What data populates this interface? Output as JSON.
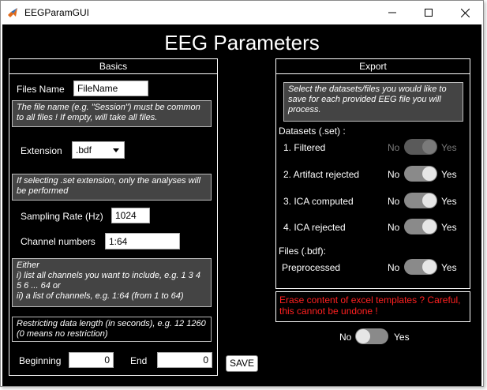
{
  "window": {
    "title": "EEGParamGUI"
  },
  "app": {
    "title": "EEG Parameters"
  },
  "basics": {
    "header": "Basics",
    "files_name_label": "Files Name",
    "files_name_value": "FileName",
    "files_name_note": "The file name (e.g. \"Session\") must be common to all files ! If empty, will take all files.",
    "extension_label": "Extension",
    "extension_value": ".bdf",
    "extension_note": "If selecting .set extension, only the analyses will be performed",
    "sampling_rate_label": "Sampling Rate (Hz)",
    "sampling_rate_value": "1024",
    "channel_numbers_label": "Channel numbers",
    "channel_numbers_value": "1:64",
    "channel_note": "Either\ni) list all channels you want to include, e.g. 1 3 4 5 6 ... 64 or\nii) a list of channels, e.g. 1:64 (from 1 to 64)",
    "restrict_note": "Restricting data length (in seconds), e.g. 12 1260 (0 means no restriction)",
    "beginning_label": "Beginning",
    "beginning_value": "0",
    "end_label": "End",
    "end_value": "0"
  },
  "save_label": "SAVE",
  "export": {
    "header": "Export",
    "note": "Select the datasets/files you would like to save for each provided EEG file you will process.",
    "datasets_label": "Datasets (.set) :",
    "items": [
      {
        "label": "1. Filtered",
        "no": "No",
        "yes": "Yes",
        "state": "disabled-yes"
      },
      {
        "label": "2. Artifact rejected",
        "no": "No",
        "yes": "Yes",
        "state": "yes"
      },
      {
        "label": "3. ICA computed",
        "no": "No",
        "yes": "Yes",
        "state": "yes"
      },
      {
        "label": "4. ICA rejected",
        "no": "No",
        "yes": "Yes",
        "state": "yes"
      }
    ],
    "files_label": "Files (.bdf):",
    "preprocessed": {
      "label": "Preprocessed",
      "no": "No",
      "yes": "Yes",
      "state": "yes"
    },
    "erase_warning": "Erase content of excel templates ? Careful, this cannot be undone !",
    "erase_no": "No",
    "erase_yes": "Yes",
    "erase_state": "no"
  },
  "colors": {
    "background": "#000000",
    "warning": "#ff2020",
    "note_bg": "#444444",
    "toggle_track": "#8a8a8a"
  }
}
